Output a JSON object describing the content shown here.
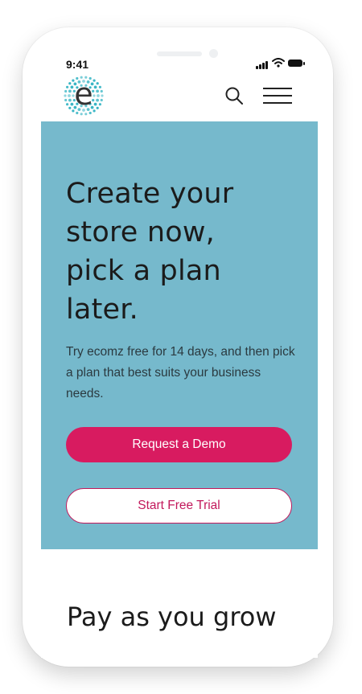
{
  "status_bar": {
    "time": "9:41"
  },
  "header": {
    "logo_letter": "e"
  },
  "hero": {
    "title_lines": [
      "Create your",
      "store now,",
      "pick a plan",
      "later."
    ],
    "description": "Try ecomz free for 14 days, and then pick a plan that best suits your business needs.",
    "primary_button": "Request a Demo",
    "secondary_button": "Start Free Trial"
  },
  "pricing": {
    "title": "Pay as you grow"
  },
  "colors": {
    "hero_bg": "#76b9cc",
    "accent": "#d81b60",
    "logo_dots": "#36b5c4"
  }
}
